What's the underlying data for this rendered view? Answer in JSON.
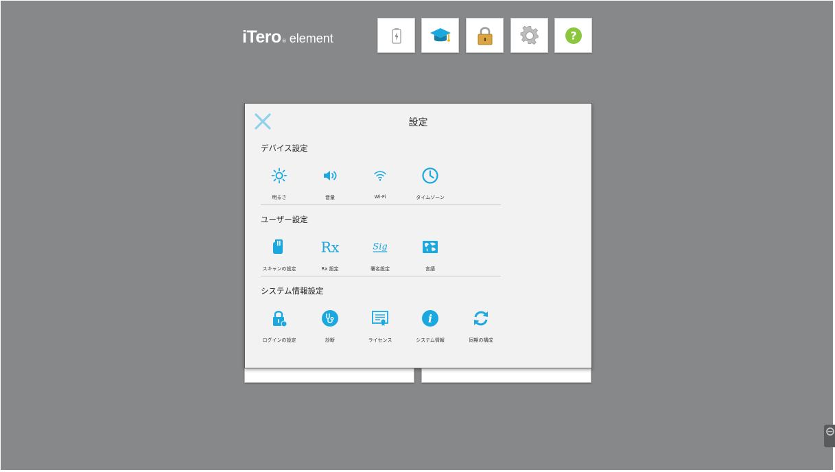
{
  "app": {
    "brand": "iTero",
    "reg_mark": "®",
    "suffix": "element"
  },
  "toolbar": {
    "items": [
      {
        "name": "battery-icon"
      },
      {
        "name": "graduation-cap-icon"
      },
      {
        "name": "lock-icon"
      },
      {
        "name": "gear-icon"
      },
      {
        "name": "help-icon",
        "glyph": "?"
      }
    ]
  },
  "colors": {
    "background": "#87888a",
    "panel": "#f2f2f2",
    "accent": "#1aa8df",
    "close": "#8fd0ee",
    "help": "#8cc63f",
    "lock": "#d9a441"
  },
  "settings": {
    "title": "設定",
    "sections": [
      {
        "title": "デバイス設定",
        "items": [
          {
            "label": "明るさ",
            "icon": "brightness-icon"
          },
          {
            "label": "音量",
            "icon": "volume-icon"
          },
          {
            "label": "Wi-Fi",
            "icon": "wifi-icon"
          },
          {
            "label": "タイムゾーン",
            "icon": "clock-icon"
          }
        ]
      },
      {
        "title": "ユーザー設定",
        "items": [
          {
            "label": "スキャンの設定",
            "icon": "scan-wand-icon"
          },
          {
            "label": "Rx 設定",
            "icon": "rx-icon",
            "glyph": "Rx"
          },
          {
            "label": "署名設定",
            "icon": "signature-icon",
            "glyph": "Sig"
          },
          {
            "label": "言語",
            "icon": "globe-map-icon"
          }
        ]
      },
      {
        "title": "システム情報設定",
        "items": [
          {
            "label": "ログインの設定",
            "icon": "login-lock-icon"
          },
          {
            "label": "診断",
            "icon": "stethoscope-icon"
          },
          {
            "label": "ライセンス",
            "icon": "certificate-icon"
          },
          {
            "label": "システム情報",
            "icon": "info-icon",
            "glyph": "i"
          },
          {
            "label": "同期の構成",
            "icon": "sync-icon"
          }
        ]
      }
    ]
  }
}
